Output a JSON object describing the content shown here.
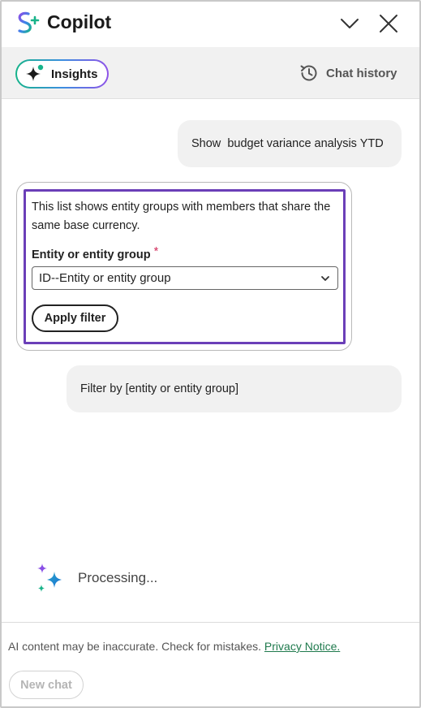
{
  "header": {
    "title": "Copilot",
    "logo_icon": "copilot-s-logo-icon",
    "minimize_icon": "chevron-down-icon",
    "close_icon": "close-icon"
  },
  "tabs": {
    "insights_label": "Insights",
    "insights_icon": "sparkle-icon",
    "history_label": "Chat history",
    "history_icon": "history-clock-icon"
  },
  "chat": {
    "user_message": "Show  budget variance analysis YTD",
    "card": {
      "description": "This list shows entity groups with members that share the same base currency.",
      "field_label": "Entity or entity group",
      "required_mark": "*",
      "select_value": "ID--Entity or entity group",
      "apply_label": "Apply filter"
    },
    "bot_message": "Filter by [entity or entity group]",
    "processing_label": "Processing..."
  },
  "footer": {
    "disclaimer": "AI content may be inaccurate. Check for mistakes.",
    "privacy_link": "Privacy Notice.",
    "new_chat_label": "New chat"
  },
  "colors": {
    "accent_purple": "#6b3fb8",
    "link_green": "#1f7a4d",
    "required_red": "#d22b5a"
  }
}
